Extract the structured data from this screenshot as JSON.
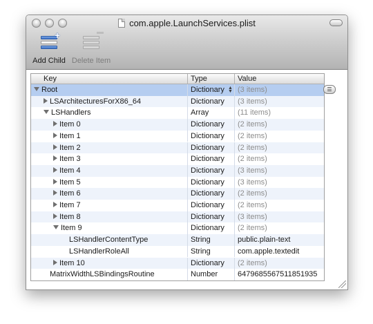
{
  "window": {
    "title": "com.apple.LaunchServices.plist"
  },
  "toolbar": {
    "add_child_label": "Add Child",
    "delete_item_label": "Delete Item"
  },
  "columns": {
    "key": "Key",
    "type": "Type",
    "value": "Value"
  },
  "rows": [
    {
      "key": "Root",
      "type": "Dictionary",
      "value": "(3 items)",
      "level": 0,
      "state": "open",
      "dim": true,
      "selected": true
    },
    {
      "key": "LSArchitecturesForX86_64",
      "type": "Dictionary",
      "value": "(3 items)",
      "level": 1,
      "state": "closed",
      "dim": true
    },
    {
      "key": "LSHandlers",
      "type": "Array",
      "value": "(11 items)",
      "level": 1,
      "state": "open",
      "dim": true
    },
    {
      "key": "Item 0",
      "type": "Dictionary",
      "value": "(2 items)",
      "level": 2,
      "state": "closed",
      "dim": true
    },
    {
      "key": "Item 1",
      "type": "Dictionary",
      "value": "(2 items)",
      "level": 2,
      "state": "closed",
      "dim": true
    },
    {
      "key": "Item 2",
      "type": "Dictionary",
      "value": "(2 items)",
      "level": 2,
      "state": "closed",
      "dim": true
    },
    {
      "key": "Item 3",
      "type": "Dictionary",
      "value": "(2 items)",
      "level": 2,
      "state": "closed",
      "dim": true
    },
    {
      "key": "Item 4",
      "type": "Dictionary",
      "value": "(3 items)",
      "level": 2,
      "state": "closed",
      "dim": true
    },
    {
      "key": "Item 5",
      "type": "Dictionary",
      "value": "(3 items)",
      "level": 2,
      "state": "closed",
      "dim": true
    },
    {
      "key": "Item 6",
      "type": "Dictionary",
      "value": "(2 items)",
      "level": 2,
      "state": "closed",
      "dim": true
    },
    {
      "key": "Item 7",
      "type": "Dictionary",
      "value": "(2 items)",
      "level": 2,
      "state": "closed",
      "dim": true
    },
    {
      "key": "Item 8",
      "type": "Dictionary",
      "value": "(3 items)",
      "level": 2,
      "state": "closed",
      "dim": true
    },
    {
      "key": "Item 9",
      "type": "Dictionary",
      "value": "(2 items)",
      "level": 2,
      "state": "open",
      "dim": true
    },
    {
      "key": "LSHandlerContentType",
      "type": "String",
      "value": "public.plain-text",
      "level": 3,
      "state": "leaf",
      "dim": false
    },
    {
      "key": "LSHandlerRoleAll",
      "type": "String",
      "value": "com.apple.textedit",
      "level": 3,
      "state": "leaf",
      "dim": false
    },
    {
      "key": "Item 10",
      "type": "Dictionary",
      "value": "(2 items)",
      "level": 2,
      "state": "closed",
      "dim": true
    },
    {
      "key": "MatrixWidthLSBindingsRoutine",
      "type": "Number",
      "value": "6479685567511851935",
      "level": 1,
      "state": "leaf",
      "dim": false
    }
  ],
  "colors": {
    "selection": "#b5cdf0",
    "alternate_row": "#eef3fb",
    "disclosure": "#6f6f6f"
  }
}
